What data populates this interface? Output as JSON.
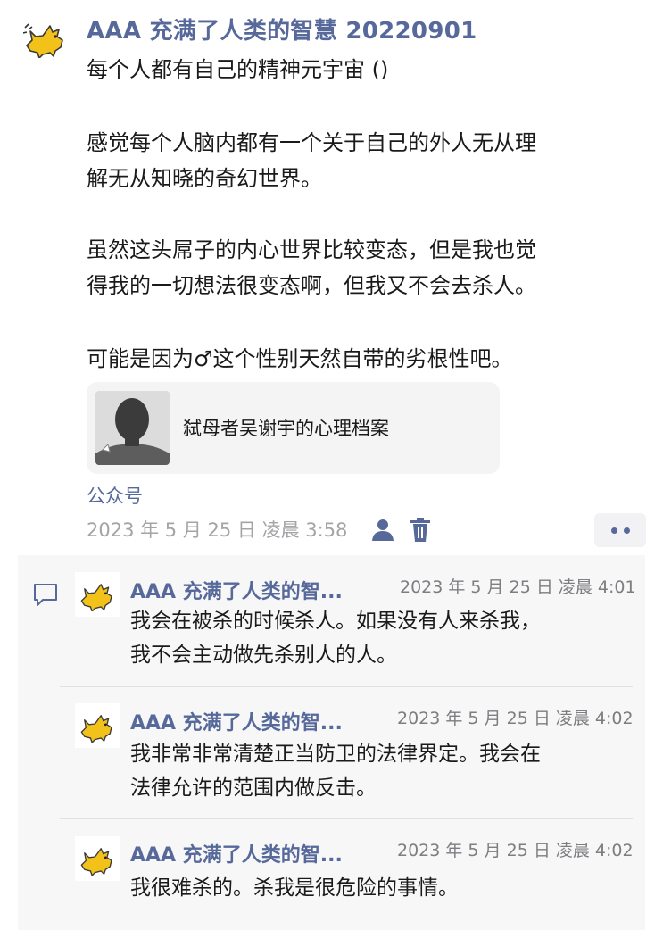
{
  "post": {
    "author": "AAA 充满了人类的智慧 20220901",
    "paragraphs": [
      "每个人都有自己的精神元宇宙 ()",
      "感觉每个人脑内都有一个关于自己的外人无从理",
      "解无从知晓的奇幻世界。",
      "虽然这头屌子的内心世界比较变态，但是我也觉",
      "得我的一切想法很变态啊，但我又不会去杀人。",
      "可能是因为♂这个性别天然自带的劣根性吧。"
    ],
    "link_card": {
      "title": "弑母者吴谢宇的心理档案"
    },
    "source": "公众号",
    "timestamp": "2023 年 5 月 25 日 凌晨 3:58",
    "icons": [
      "person-icon",
      "trash-icon",
      "more-icon"
    ]
  },
  "comments": [
    {
      "author": "AAA 充满了人类的智...",
      "time": "2023 年 5 月 25 日 凌晨 4:01",
      "lines": [
        "我会在被杀的时候杀人。如果没有人来杀我，",
        "我不会主动做先杀别人的人。"
      ]
    },
    {
      "author": "AAA 充满了人类的智...",
      "time": "2023 年 5 月 25 日 凌晨 4:02",
      "lines": [
        "我非常非常清楚正当防卫的法律界定。我会在",
        "法律允许的范围内做反击。"
      ]
    },
    {
      "author": "AAA 充满了人类的智...",
      "time": "2023 年 5 月 25 日 凌晨 4:02",
      "lines": [
        "我很难杀的。杀我是很危险的事情。"
      ]
    }
  ],
  "colors": {
    "name": "#56699a",
    "muted": "#a4a4a8",
    "panel": "#f7f7f7",
    "cat": "#f2c21b"
  }
}
